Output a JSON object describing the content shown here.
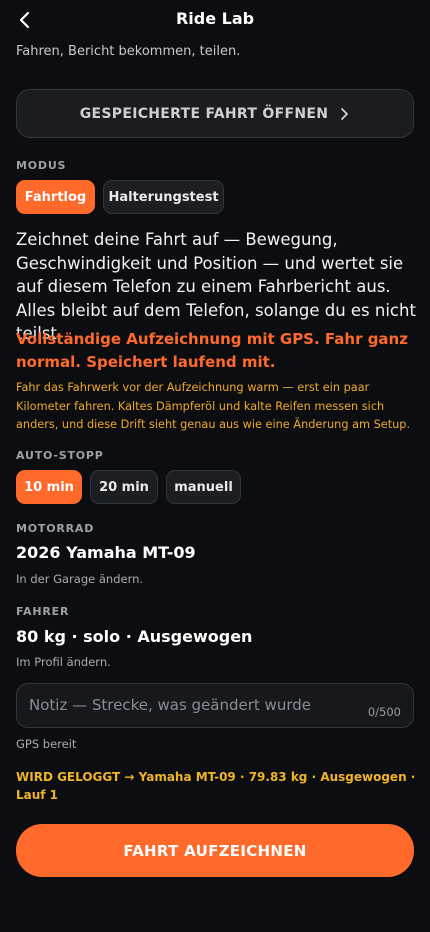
{
  "header": {
    "title": "Ride Lab",
    "back_icon": "chevron-left-icon"
  },
  "subtitle": "Fahren, Bericht bekommen, teilen.",
  "open_saved": {
    "label": "GESPEICHERTE FAHRT ÖFFNEN",
    "icon": "chevron-right-icon"
  },
  "mode": {
    "label": "MODUS",
    "options": [
      {
        "label": "Fahrtlog",
        "active": true
      },
      {
        "label": "Halterungstest",
        "active": false
      }
    ]
  },
  "description": "Zeichnet deine Fahrt auf — Bewegung, Geschwindigkeit und Position — und wertet sie auf diesem Telefon zu einem Fahrbericht aus. Alles bleibt auf dem Telefon, solange du es nicht teilst.",
  "gps_note": "Vollständige Aufzeichnung mit GPS. Fahr ganz normal. Speichert laufend mit.",
  "warmup_note": "Fahr das Fahrwerk vor der Aufzeichnung warm — erst ein paar Kilometer fahren. Kaltes Dämpferöl und kalte Reifen messen sich anders, und diese Drift sieht genau aus wie eine Änderung am Setup.",
  "auto_stop": {
    "label": "AUTO-STOPP",
    "options": [
      {
        "label": "10 min",
        "active": true
      },
      {
        "label": "20 min",
        "active": false
      },
      {
        "label": "manuell",
        "active": false
      }
    ]
  },
  "motorcycle": {
    "label": "MOTORRAD",
    "value": "2026 Yamaha MT-09",
    "hint": "In der Garage ändern."
  },
  "rider": {
    "label": "FAHRER",
    "value": "80 kg · solo · Ausgewogen",
    "hint": "Im Profil ändern."
  },
  "note": {
    "placeholder": "Notiz — Strecke, was geändert wurde",
    "count": "0/500"
  },
  "gps_status": "GPS bereit",
  "logged_line": "WIRD GELOGGT → Yamaha MT-09 · 79.83 kg · Ausgewogen · Lauf 1",
  "record_button": "FAHRT AUFZEICHNEN",
  "colors": {
    "accent": "#ff6a2b",
    "warning": "#f0b429",
    "background": "#0c0d11"
  }
}
